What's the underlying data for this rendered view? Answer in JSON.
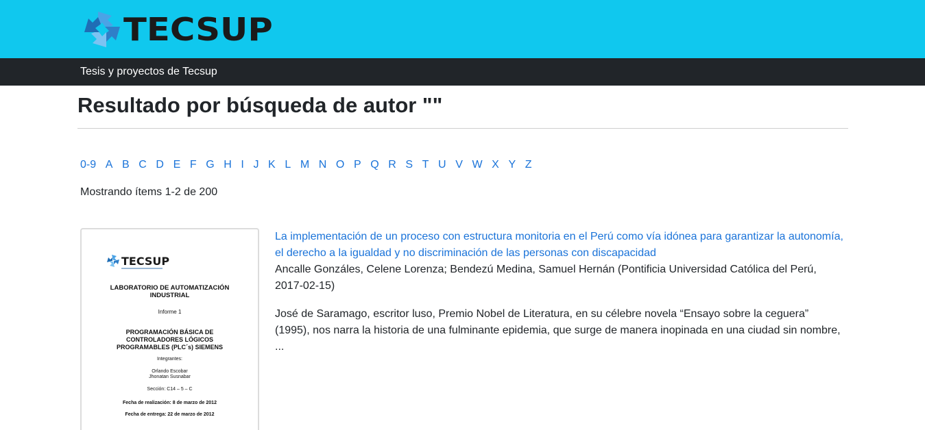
{
  "header": {
    "logo_text": "TECSUP",
    "colors": {
      "header_bg": "#10c8ee",
      "navbar_bg": "#212529",
      "link": "#1a73d9"
    }
  },
  "navbar": {
    "brand": "Tesis y proyectos de Tecsup"
  },
  "page": {
    "title": "Resultado por búsqueda de autor \"\"",
    "alphabet": [
      "0-9",
      "A",
      "B",
      "C",
      "D",
      "E",
      "F",
      "G",
      "H",
      "I",
      "J",
      "K",
      "L",
      "M",
      "N",
      "O",
      "P",
      "Q",
      "R",
      "S",
      "T",
      "U",
      "V",
      "W",
      "X",
      "Y",
      "Z"
    ],
    "showing": "Mostrando ítems 1-2 de 200"
  },
  "result": {
    "thumbnail": {
      "logo_text": "TECSUP",
      "lines": [
        "LABORATORIO DE AUTOMATIZACIÓN",
        "INDUSTRIAL",
        "Informe 1",
        "PROGRAMACIÓN BÁSICA DE",
        "CONTROLADORES LÓGICOS",
        "PROGRAMABLES (PLC´s) SIEMENS",
        "Integrantes:",
        "Orlando Escobar",
        "Jhonatan Susnabar",
        "Sección: C14 – 5 – C",
        "Fecha de realización: 8 de marzo de 2012",
        "Fecha de entrega: 22 de marzo de 2012"
      ]
    },
    "title": "La implementación de un proceso con estructura monitoria en el Perú como vía idónea para garantizar la autonomía, el derecho a la igualdad y no discriminación de las personas con discapacidad",
    "authors": "Ancalle Gonzáles, Celene Lorenza; Bendezú Medina, Samuel Hernán (Pontificia Universidad Católica del Perú, 2017-02-15)",
    "abstract": "José de Saramago, escritor luso, Premio Nobel de Literatura, en su célebre novela “Ensayo sobre la ceguera” (1995), nos narra la historia de una fulminante epidemia, que surge de manera inopinada en una ciudad sin nombre, ..."
  }
}
